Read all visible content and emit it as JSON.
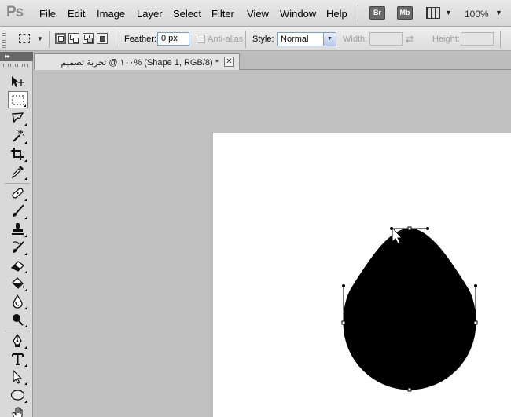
{
  "app": {
    "logo": "Ps"
  },
  "menu": [
    "File",
    "Edit",
    "Image",
    "Layer",
    "Select",
    "Filter",
    "View",
    "Window",
    "Help"
  ],
  "app_bar": {
    "bridge_label": "Br",
    "mini_bridge_label": "Mb",
    "zoom": "100%"
  },
  "options": {
    "feather_label": "Feather:",
    "feather_value": "0 px",
    "antialias_label": "Anti-alias",
    "style_label": "Style:",
    "style_value": "Normal",
    "width_label": "Width:",
    "height_label": "Height:"
  },
  "document": {
    "tab_title": "١٠٠ @ تجربة تصميم% (Shape 1, RGB/8) *",
    "close_glyph": "✕"
  },
  "tools": [
    "move-tool",
    "rectangular-marquee-tool",
    "lasso-tool",
    "quick-selection-tool",
    "crop-tool",
    "eyedropper-tool",
    "spot-healing-brush-tool",
    "brush-tool",
    "clone-stamp-tool",
    "history-brush-tool",
    "eraser-tool",
    "paint-bucket-tool",
    "blur-tool",
    "dodge-tool",
    "pen-tool",
    "type-tool",
    "path-selection-tool",
    "ellipse-tool",
    "hand-tool"
  ],
  "active_tool": "rectangular-marquee-tool",
  "colors": {
    "shape_fill": "#000000",
    "canvas_bg": "#c0c0c0",
    "document_bg": "#ffffff"
  }
}
